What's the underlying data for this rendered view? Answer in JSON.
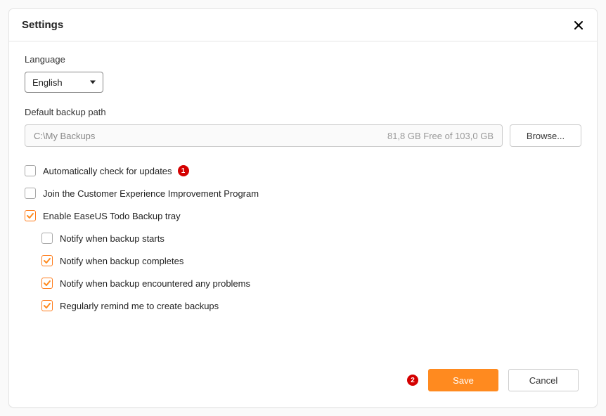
{
  "title": "Settings",
  "language": {
    "label": "Language",
    "value": "English"
  },
  "backup_path": {
    "label": "Default backup path",
    "value": "C:\\My Backups",
    "free_text": "81,8 GB Free of 103,0 GB",
    "browse_label": "Browse..."
  },
  "options": {
    "auto_update": {
      "label": "Automatically check for updates",
      "checked": false
    },
    "cei_program": {
      "label": "Join the Customer Experience Improvement Program",
      "checked": false
    },
    "tray": {
      "label": "Enable EaseUS Todo Backup tray",
      "checked": true
    },
    "tray_children": {
      "notify_starts": {
        "label": "Notify when backup starts",
        "checked": false
      },
      "notify_completes": {
        "label": "Notify when backup completes",
        "checked": true
      },
      "notify_problems": {
        "label": "Notify when backup encountered any problems",
        "checked": true
      },
      "remind": {
        "label": "Regularly remind me to create backups",
        "checked": true
      }
    }
  },
  "footer": {
    "save": "Save",
    "cancel": "Cancel"
  },
  "callouts": {
    "one": "1",
    "two": "2"
  },
  "colors": {
    "accent": "#ff8a1f",
    "danger": "#d40000"
  }
}
